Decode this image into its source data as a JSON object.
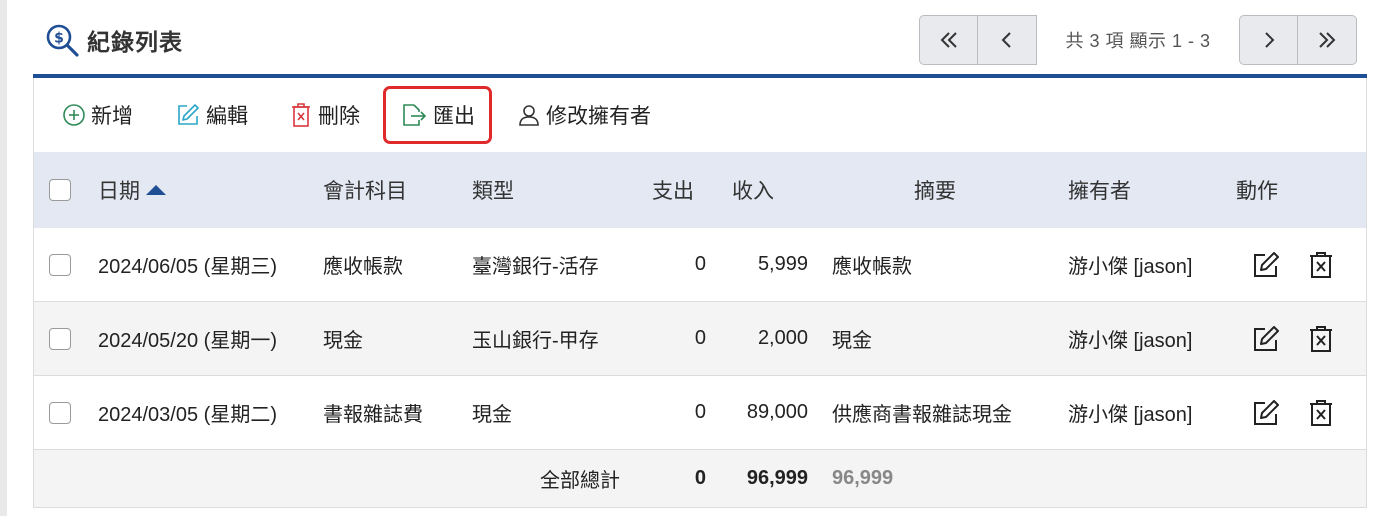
{
  "header": {
    "title": "紀錄列表",
    "pager_info": "共 3 項 顯示 1 - 3"
  },
  "toolbar": {
    "add": "新增",
    "edit": "編輯",
    "delete": "刪除",
    "export": "匯出",
    "change_owner": "修改擁有者"
  },
  "table": {
    "columns": [
      "日期",
      "會計科目",
      "類型",
      "支出",
      "收入",
      "摘要",
      "擁有者",
      "動作"
    ],
    "rows": [
      {
        "date": "2024/06/05 (星期三)",
        "account": "應收帳款",
        "type": "臺灣銀行-活存",
        "expense": "0",
        "income": "5,999",
        "summary": "應收帳款",
        "owner": "游小傑 [jason]"
      },
      {
        "date": "2024/05/20 (星期一)",
        "account": "現金",
        "type": "玉山銀行-甲存",
        "expense": "0",
        "income": "2,000",
        "summary": "現金",
        "owner": "游小傑 [jason]"
      },
      {
        "date": "2024/03/05 (星期二)",
        "account": "書報雜誌費",
        "type": "現金",
        "expense": "0",
        "income": "89,000",
        "summary": "供應商書報雜誌現金",
        "owner": "游小傑 [jason]"
      }
    ],
    "footer": {
      "label": "全部總計",
      "expense_total": "0",
      "income_total": "96,999",
      "net_total": "96,999"
    }
  },
  "colors": {
    "accent": "#1f4e94",
    "header_bg": "#e3e8f3",
    "highlight": "#e0292b",
    "add_icon": "#2e8b57",
    "edit_icon": "#2aa7c9",
    "delete_icon": "#d9363e",
    "export_icon": "#2e8b57"
  }
}
